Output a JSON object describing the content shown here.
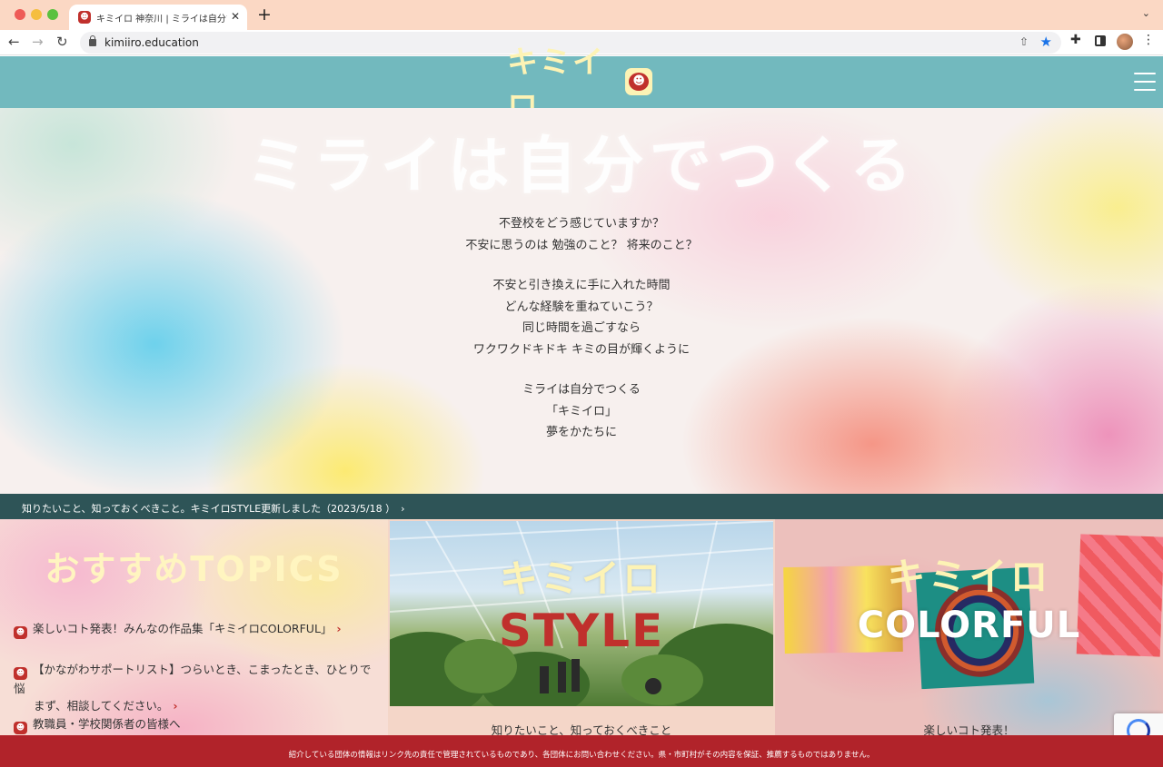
{
  "browser": {
    "tab_title": "キミイロ 神奈川 | ミライは自分で",
    "url": "kimiiro.education",
    "icons": [
      "close-icon",
      "plus-icon",
      "chevron-down-icon",
      "back-icon",
      "forward-icon",
      "reload-icon",
      "lock-icon",
      "share-icon",
      "star-icon",
      "extensions-icon",
      "sidepanel-icon",
      "profile-icon",
      "kebab-icon"
    ]
  },
  "header": {
    "logo_text": "キミイロ",
    "logo_face": "☻",
    "menu_icon": "hamburger-icon",
    "bg_color": "#72b9be"
  },
  "hero": {
    "title": "ミライは自分でつくる",
    "poem": [
      [
        "不登校をどう感じていますか？",
        "不安に思うのは 勉強のこと？ 将来のこと？"
      ],
      [
        "不安と引き換えに手に入れた時間",
        "どんな経験を重ねていこう？",
        "同じ時間を過ごすなら",
        "ワクワクドキドキ キミの目が輝くように"
      ],
      [
        "ミライは自分でつくる",
        "「キミイロ」",
        "夢をかたちに"
      ]
    ]
  },
  "news": {
    "text": "知りたいこと、知っておくべきこと。キミイロSTYLE更新しました（2023/5/18 ）",
    "chevron": "›"
  },
  "topics": {
    "title": "おすすめTOPICS",
    "items": [
      {
        "line1": "楽しいコト発表！みんなの作品集「キミイロCOLORFUL」",
        "line2": ""
      },
      {
        "line1": "【かながわサポートリスト】つらいとき、こまったとき、ひとりで悩",
        "line2": "まず、相談してください。"
      },
      {
        "line1": "教職員・学校関係者の皆様へ",
        "line2": ""
      }
    ]
  },
  "style_panel": {
    "logo": "キミイロ",
    "word": "STYLE",
    "caption": "知りたいこと、知っておくべきこと"
  },
  "colorful_panel": {
    "logo": "キミイロ",
    "word": "COLORFUL",
    "caption": "楽しいコト発表！"
  },
  "footer": {
    "disclaimer": "紹介している団体の情報はリンク先の責任で管理されているものであり、各団体にお問い合わせください。県・市町村がその内容を保証、推薦するものではありません。",
    "bg_color": "#b1232a"
  }
}
